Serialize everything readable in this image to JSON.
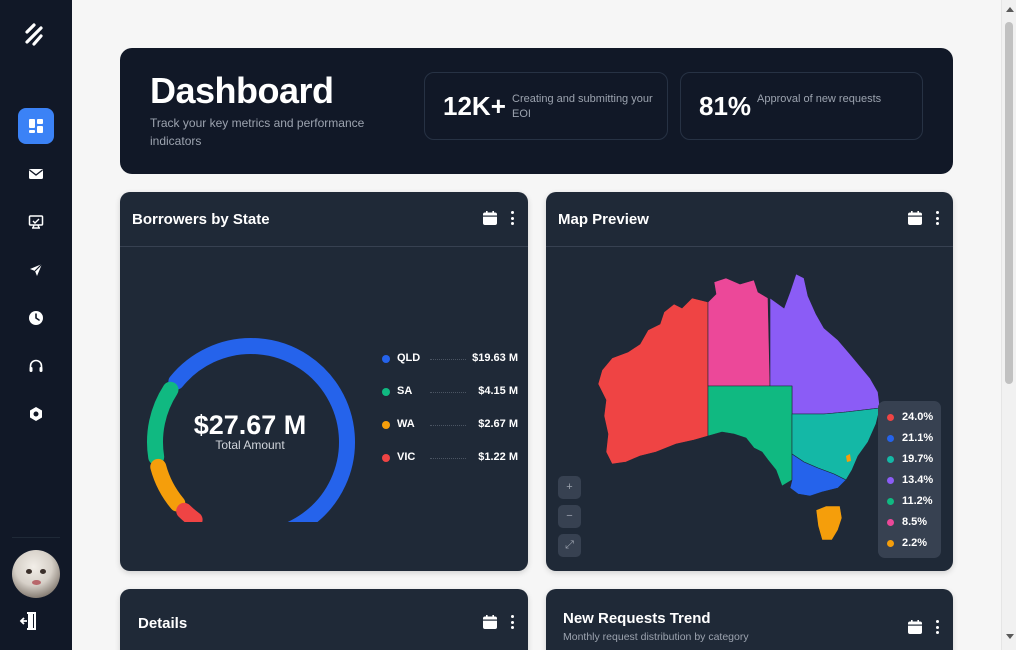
{
  "header": {
    "title": "Dashboard",
    "subtitle": "Track your key metrics and performance indicators",
    "stats": [
      {
        "value": "12K+",
        "label": "Creating and submitting your EOI"
      },
      {
        "value": "81%",
        "label": "Approval of new requests"
      }
    ]
  },
  "sidebar": {
    "items": [
      {
        "icon": "dashboard-icon",
        "active": true
      },
      {
        "icon": "mail-icon",
        "active": false
      },
      {
        "icon": "monitor-icon",
        "active": false
      },
      {
        "icon": "send-icon",
        "active": false
      },
      {
        "icon": "clock-icon",
        "active": false
      },
      {
        "icon": "headset-icon",
        "active": false
      },
      {
        "icon": "settings-icon",
        "active": false
      }
    ],
    "footer_icon": "logout-icon"
  },
  "borrowers": {
    "title": "Borrowers by State",
    "total": "$27.67 M",
    "total_label": "Total Amount",
    "legend": [
      {
        "state": "QLD",
        "value": "$19.63 M",
        "color": "#2563eb",
        "amount": 19.63
      },
      {
        "state": "SA",
        "value": "$4.15 M",
        "color": "#10b981",
        "amount": 4.15
      },
      {
        "state": "WA",
        "value": "$2.67 M",
        "color": "#f59e0b",
        "amount": 2.67
      },
      {
        "state": "VIC",
        "value": "$1.22 M",
        "color": "#ef4444",
        "amount": 1.22
      }
    ]
  },
  "map_preview": {
    "title": "Map Preview",
    "controls": [
      "+",
      "−",
      "⤢"
    ],
    "legend": [
      {
        "value": "24.0%",
        "color": "#ef4444"
      },
      {
        "value": "21.1%",
        "color": "#2563eb"
      },
      {
        "value": "19.7%",
        "color": "#14b8a6"
      },
      {
        "value": "13.4%",
        "color": "#8b5cf6"
      },
      {
        "value": "11.2%",
        "color": "#10b981"
      },
      {
        "value": "8.5%",
        "color": "#ec4899"
      },
      {
        "value": "2.2%",
        "color": "#f59e0b"
      }
    ]
  },
  "details": {
    "title": "Details"
  },
  "trend": {
    "title": "New Requests Trend",
    "subtitle": "Monthly request distribution by category"
  }
}
